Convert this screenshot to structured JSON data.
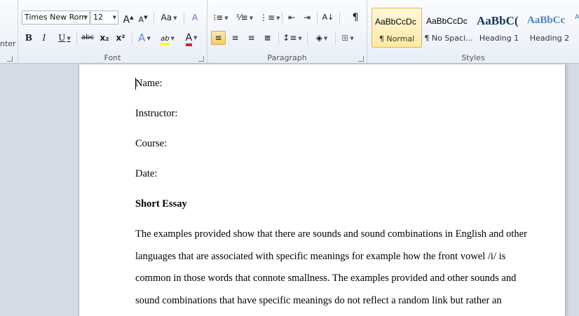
{
  "ribbon": {
    "clipboard": {
      "partial_label": "nter"
    },
    "font": {
      "group_label": "Font",
      "font_name": "Times New Rom",
      "font_size": "12",
      "grow_font": "A",
      "shrink_font": "A",
      "change_case": "Aa",
      "clear_format": "A",
      "bold": "B",
      "italic": "I",
      "underline": "U",
      "strikethrough": "abc",
      "subscript": "x₂",
      "superscript": "x²",
      "text_effects": "A",
      "highlight": "ab",
      "font_color": "A"
    },
    "paragraph": {
      "group_label": "Paragraph",
      "pilcrow": "¶"
    },
    "styles": {
      "group_label": "Styles",
      "items": [
        {
          "sample": "AaBbCcDc",
          "name": "¶ Normal"
        },
        {
          "sample": "AaBbCcDc",
          "name": "¶ No Spaci..."
        },
        {
          "sample": "AaBbC(",
          "name": "Heading 1"
        },
        {
          "sample": "AaBbCc",
          "name": "Heading 2"
        }
      ]
    }
  },
  "document": {
    "name_line": "Name:",
    "instructor_line": "Instructor:",
    "course_line": "Course:",
    "date_line": "Date:",
    "title": "Short Essay",
    "body_lines": [
      "The examples provided show that there are sounds and sound combinations in English and other",
      "languages that are associated with specific meanings for example how the front vowel /i/ is",
      "common in those words that connote smallness. The examples provided and other sounds and",
      "sound combinations that have specific meanings do not reflect a random link but rather an"
    ]
  },
  "colors": {
    "highlight": "#ffff00",
    "font_color": "#e02020",
    "heading_blue": "#17365d",
    "heading2_blue": "#4f81bd"
  }
}
